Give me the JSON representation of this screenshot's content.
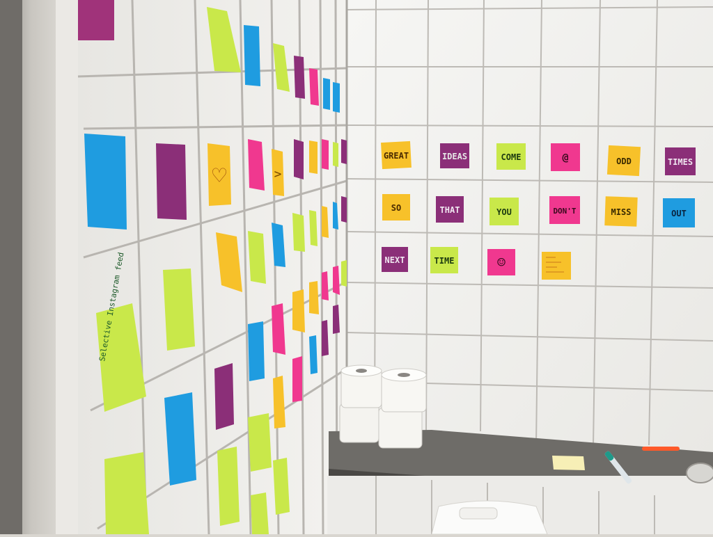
{
  "scene": {
    "description_free": true,
    "colors": {
      "tile": "#f1f1ef",
      "grout": "#b9b6b1",
      "shelf": "#6b6965",
      "pink": "#f0388f",
      "purple": "#8b2f78",
      "blue": "#1f9ce0",
      "yellow": "#f7c12a",
      "green": "#c9e84a",
      "paper": "#f2f0ec"
    }
  },
  "wall_message": {
    "row1": [
      "GREAT",
      "IDEAS",
      "COME",
      "@",
      "ODD",
      "TIMES"
    ],
    "row2": [
      "SO",
      "THAT",
      "YOU",
      "DON'T",
      "MISS",
      "OUT"
    ],
    "row3": [
      "NEXT",
      "TIME",
      "☺"
    ]
  },
  "side_notes": {
    "heart": "♡",
    "arrow": ">",
    "left_green": "Selective Instagram feed"
  }
}
